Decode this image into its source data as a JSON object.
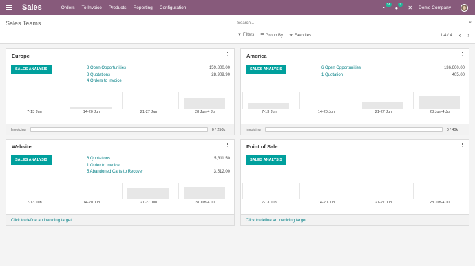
{
  "nav": {
    "brand": "Sales",
    "menu": [
      "Orders",
      "To Invoice",
      "Products",
      "Reporting",
      "Configuration"
    ],
    "activity_badge": "34",
    "messages_badge": "7",
    "company": "Demo Company"
  },
  "control": {
    "breadcrumb": "Sales Teams",
    "search_placeholder": "Search...",
    "filters_label": "Filters",
    "groupby_label": "Group By",
    "favorites_label": "Favorites",
    "pager": "1-4 / 4"
  },
  "cards": [
    {
      "title": "Europe",
      "button": "SALES ANALYSIS",
      "stats": [
        {
          "label": "8 Open Opportunities",
          "value": "159,800.00"
        },
        {
          "label": "8 Quotations",
          "value": "28,909.90"
        },
        {
          "label": "4 Orders to Invoice",
          "value": ""
        }
      ],
      "x_labels": [
        "7-13 Jun",
        "14-20 Jun",
        "21-27 Jun",
        "28 Jun-4 Jul"
      ],
      "bar_levels": [
        0,
        0.08,
        0,
        0.75
      ],
      "footer_type": "invoicing",
      "footer_label": "Invoicing",
      "footer_ratio": "0 / 250k",
      "progress": 0
    },
    {
      "title": "America",
      "button": "SALES ANALYSIS",
      "stats": [
        {
          "label": "6 Open Opportunities",
          "value": "136,600.00"
        },
        {
          "label": "1 Quotation",
          "value": "405.00"
        }
      ],
      "x_labels": [
        "7-13 Jun",
        "14-20 Jun",
        "21-27 Jun",
        "28 Jun-4 Jul"
      ],
      "bar_levels": [
        0.4,
        0,
        0.45,
        0.9
      ],
      "footer_type": "invoicing",
      "footer_label": "Invoicing",
      "footer_ratio": "0 / 40k",
      "progress": 0
    },
    {
      "title": "Website",
      "button": "SALES ANALYSIS",
      "stats": [
        {
          "label": "6 Quotations",
          "value": "5,311.50"
        },
        {
          "label": "1 Order to Invoice",
          "value": ""
        },
        {
          "label": "5 Abandoned Carts to Recover",
          "value": "3,512.00"
        }
      ],
      "x_labels": [
        "7-13 Jun",
        "14-20 Jun",
        "21-27 Jun",
        "28 Jun-4 Jul"
      ],
      "bar_levels": [
        0,
        0,
        0.85,
        0.9
      ],
      "footer_type": "link",
      "footer_link": "Click to define an invoicing target"
    },
    {
      "title": "Point of Sale",
      "button": "SALES ANALYSIS",
      "stats": [],
      "x_labels": [
        "7-13 Jun",
        "14-20 Jun",
        "21-27 Jun",
        "28 Jun-4 Jul"
      ],
      "bar_levels": [
        0,
        0,
        0,
        0
      ],
      "footer_type": "link",
      "footer_link": "Click to define an invoicing target"
    }
  ]
}
